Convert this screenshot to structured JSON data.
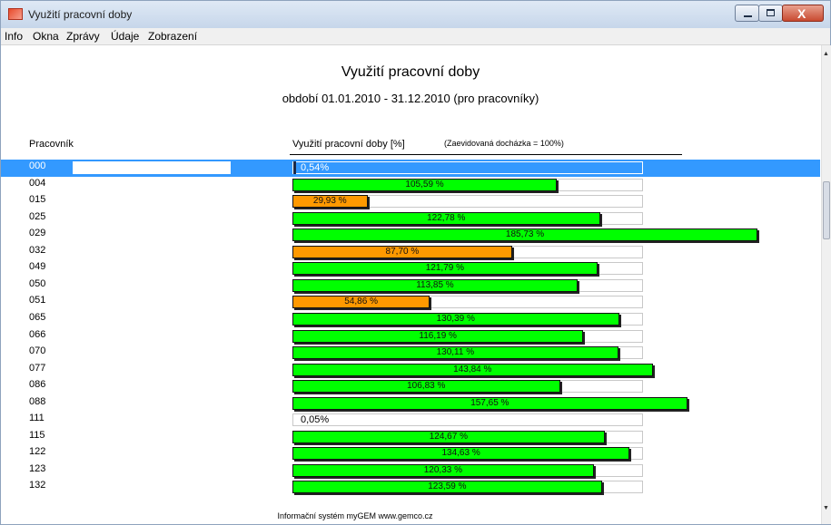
{
  "window": {
    "title": "Využití pracovní doby",
    "close_glyph": "X"
  },
  "menu": [
    "Info",
    "Okna",
    "Zprávy",
    "Údaje",
    "Zobrazení"
  ],
  "report": {
    "title": "Využití pracovní doby",
    "subtitle": "období 01.01.2010 - 31.12.2010 (pro pracovníky)",
    "col_worker": "Pracovník",
    "col_usage": "Využití pracovní doby [%]",
    "col_note": "(Zaevidovaná docházka = 100%)",
    "footer": "Informační systém myGEM   www.gemco.cz"
  },
  "colors": {
    "selection": "#3399ff",
    "over_threshold": "#00ff00",
    "under_threshold": "#ff9900"
  },
  "scale_max_percent": 140,
  "rows": [
    {
      "id": "000",
      "value": 0.54,
      "label": "0,54%",
      "selected": true
    },
    {
      "id": "004",
      "value": 105.59,
      "label": "105,59 %"
    },
    {
      "id": "015",
      "value": 29.93,
      "label": "29,93 %"
    },
    {
      "id": "025",
      "value": 122.78,
      "label": "122,78 %"
    },
    {
      "id": "029",
      "value": 185.73,
      "label": "185,73 %"
    },
    {
      "id": "032",
      "value": 87.7,
      "label": "87,70 %"
    },
    {
      "id": "049",
      "value": 121.79,
      "label": "121,79 %"
    },
    {
      "id": "050",
      "value": 113.85,
      "label": "113,85 %"
    },
    {
      "id": "051",
      "value": 54.86,
      "label": "54,86 %"
    },
    {
      "id": "065",
      "value": 130.39,
      "label": "130,39 %"
    },
    {
      "id": "066",
      "value": 116.19,
      "label": "116,19 %"
    },
    {
      "id": "070",
      "value": 130.11,
      "label": "130,11 %"
    },
    {
      "id": "077",
      "value": 143.84,
      "label": "143,84 %"
    },
    {
      "id": "086",
      "value": 106.83,
      "label": "106,83 %"
    },
    {
      "id": "088",
      "value": 157.65,
      "label": "157,65 %"
    },
    {
      "id": "111",
      "value": 0.05,
      "label": "0,05%"
    },
    {
      "id": "115",
      "value": 124.67,
      "label": "124,67 %"
    },
    {
      "id": "122",
      "value": 134.63,
      "label": "134,63 %"
    },
    {
      "id": "123",
      "value": 120.33,
      "label": "120,33 %"
    },
    {
      "id": "132",
      "value": 123.59,
      "label": "123,59 %"
    }
  ]
}
